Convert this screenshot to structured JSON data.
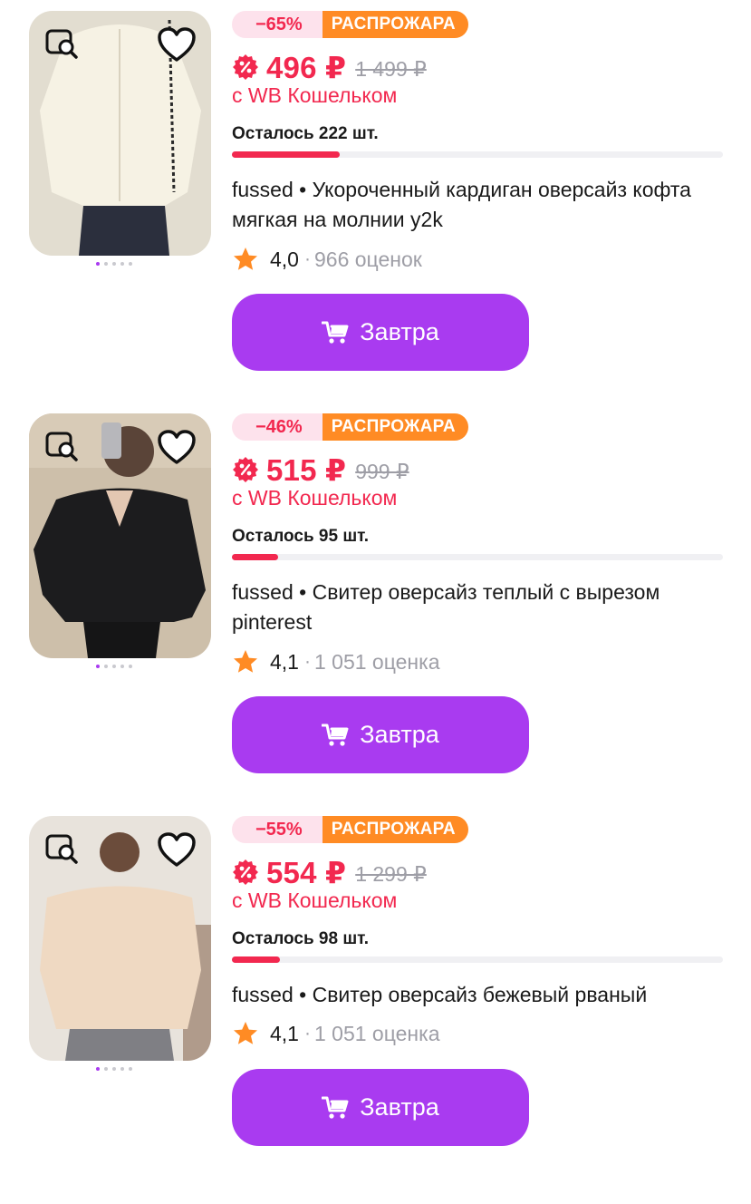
{
  "colors": {
    "accent": "#a93bf0",
    "price": "#f2284f",
    "sale": "#ff8b24",
    "muted": "#9e9ea6"
  },
  "icons": {
    "find_similar": "image-search-icon",
    "favorite": "heart-icon",
    "price_badge": "wallet-discount-icon",
    "rating": "star-icon",
    "cart": "cart-icon"
  },
  "products": [
    {
      "discount": "−65%",
      "sale_label": "РАСПРОЖАРА",
      "price": "496 ₽",
      "old_price": "1 499 ₽",
      "wallet_text": "с WB Кошельком",
      "stock_text": "Осталось 222 шт.",
      "stock_fill_fraction": 0.22,
      "title": "fussed • Укороченный кардиган оверсайз кофта мягкая на молнии y2k",
      "rating": "4,0",
      "rating_sep": "·",
      "reviews": "966 оценок",
      "button": "Завтра",
      "photo_colors": [
        "#efe9dd",
        "#f6f2e6",
        "#2b2f3d"
      ]
    },
    {
      "discount": "−46%",
      "sale_label": "РАСПРОЖАРА",
      "price": "515 ₽",
      "old_price": "999 ₽",
      "wallet_text": "с WB Кошельком",
      "stock_text": "Осталось 95 шт.",
      "stock_fill_fraction": 0.095,
      "title": "fussed • Свитер оверсайз теплый с вырезом pinterest",
      "rating": "4,1",
      "rating_sep": "·",
      "reviews": "1 051 оценка",
      "button": "Завтра",
      "photo_colors": [
        "#cbbfae",
        "#1b1b1d",
        "#d9cdbb"
      ]
    },
    {
      "discount": "−55%",
      "sale_label": "РАСПРОЖАРА",
      "price": "554 ₽",
      "old_price": "1 299 ₽",
      "wallet_text": "с WB Кошельком",
      "stock_text": "Осталось 98 шт.",
      "stock_fill_fraction": 0.098,
      "title": "fussed • Свитер оверсайз бежевый рваный",
      "rating": "4,1",
      "rating_sep": "·",
      "reviews": "1 051 оценка",
      "button": "Завтра",
      "photo_colors": [
        "#e6e1da",
        "#efd9c3",
        "#7c7c80"
      ]
    }
  ]
}
